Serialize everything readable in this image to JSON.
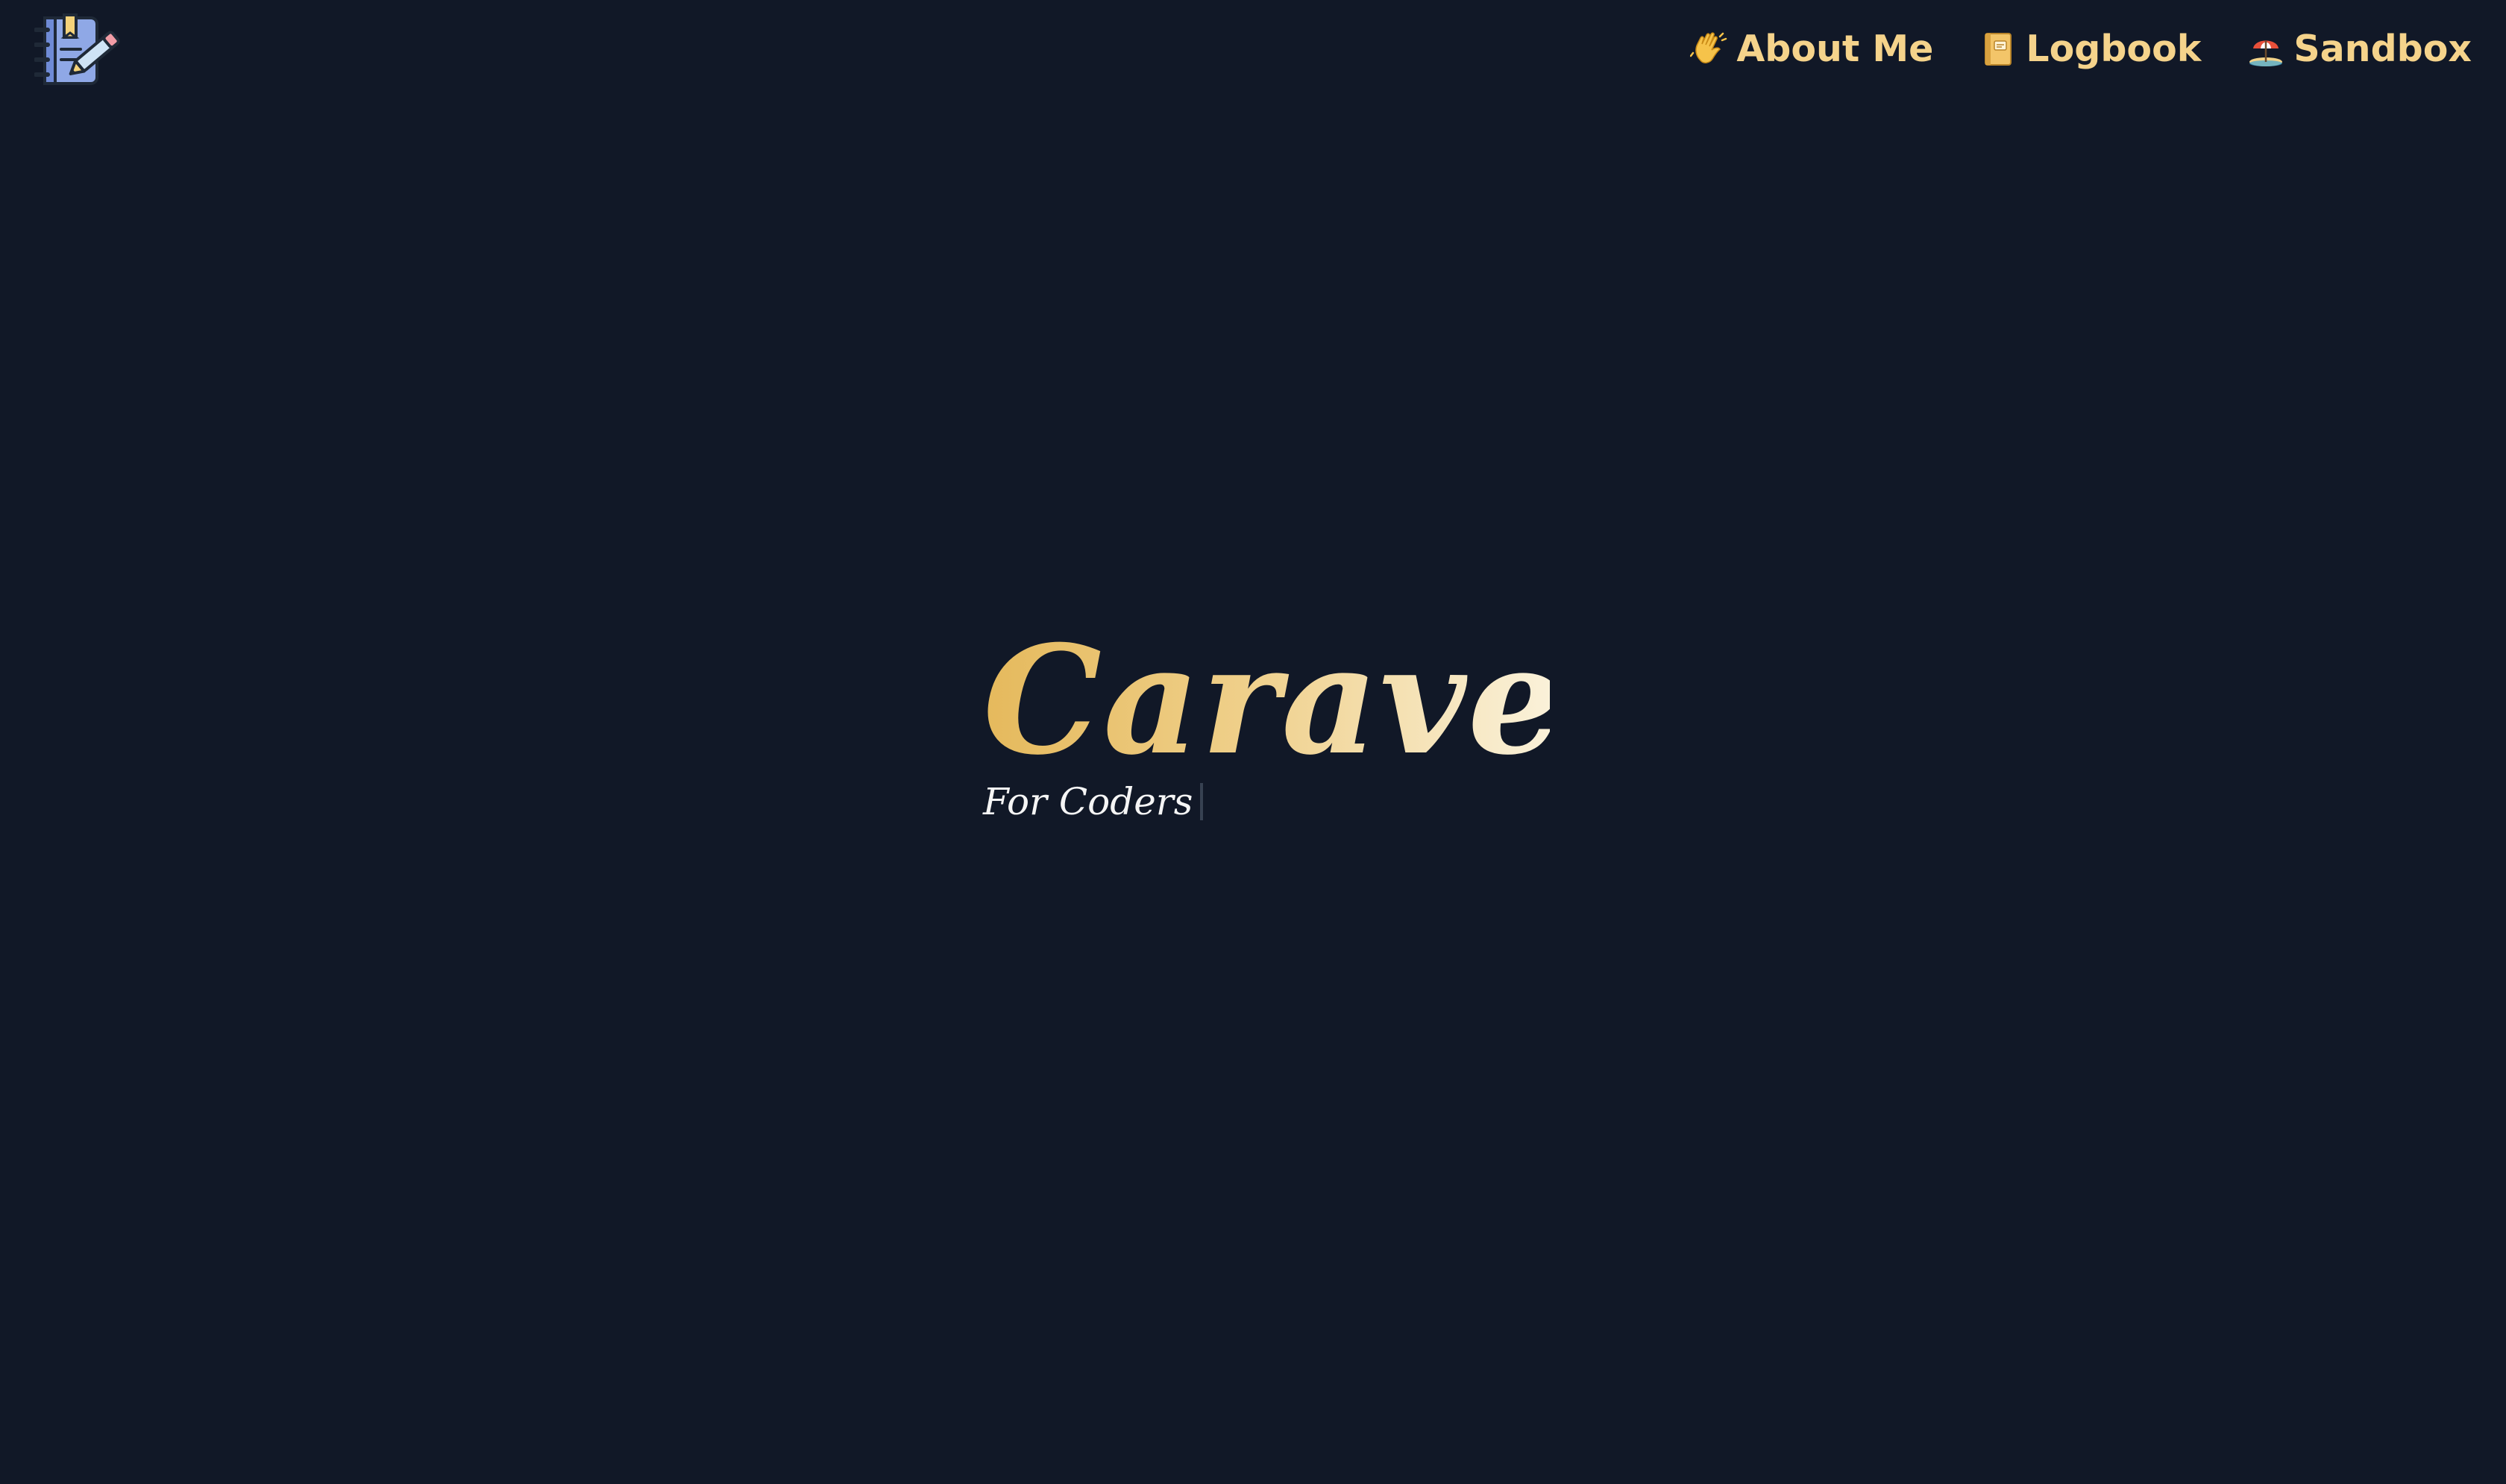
{
  "header": {
    "logo_icon": "notebook-pencil-icon",
    "nav": [
      {
        "icon": "waving-hand-icon",
        "label": "About Me"
      },
      {
        "icon": "notebook-icon",
        "label": "Logbook"
      },
      {
        "icon": "beach-umbrella-icon",
        "label": "Sandbox"
      }
    ]
  },
  "hero": {
    "title": "Caravel",
    "subtitle": "For Coders"
  },
  "colors": {
    "background": "#111827",
    "accent": "#F5D38B",
    "title_gradient_start": "#E5B95C",
    "title_gradient_end": "#FAF1D9",
    "subtitle": "#F5F5F5"
  }
}
